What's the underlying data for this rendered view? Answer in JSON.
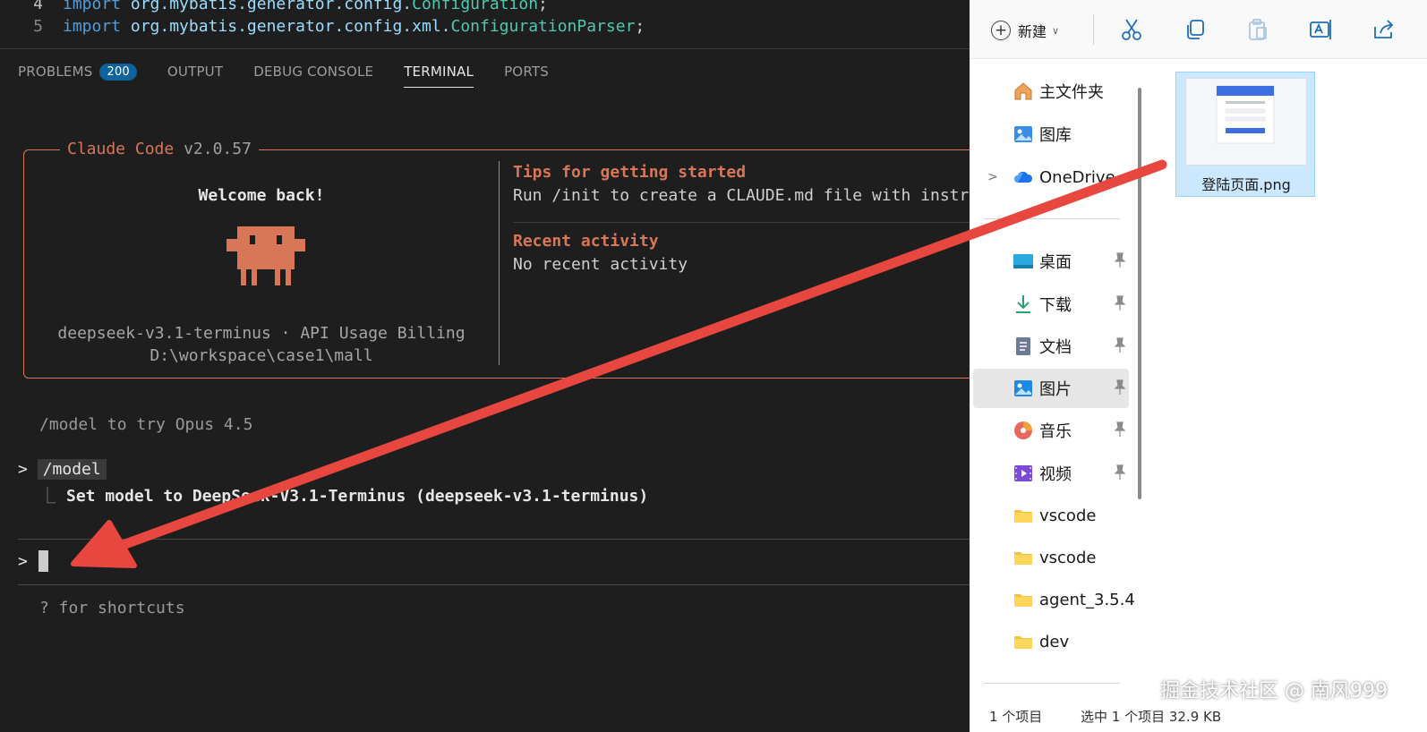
{
  "editor": {
    "lines": [
      {
        "num": "4",
        "kw": "import",
        "pkg": "org.mybatis.generator.config.",
        "cls": "Configuration",
        "end": ";"
      },
      {
        "num": "5",
        "kw": "import",
        "pkg": "org.mybatis.generator.config.xml.",
        "cls": "ConfigurationParser",
        "end": ";"
      }
    ]
  },
  "panel": {
    "tabs": [
      "PROBLEMS",
      "OUTPUT",
      "DEBUG CONSOLE",
      "TERMINAL",
      "PORTS"
    ],
    "problems_badge": "200",
    "active_tab": "TERMINAL"
  },
  "terminal": {
    "app_name": "Claude Code",
    "app_version": "v2.0.57",
    "welcome": "Welcome back!",
    "model_info": "deepseek-v3.1-terminus · API Usage Billing",
    "path": "D:\\workspace\\case1\\mall",
    "tips_heading": "Tips for getting started",
    "tips_text": "Run /init to create a CLAUDE.md file with instructions for Claude",
    "recent_heading": "Recent activity",
    "recent_text": "No recent activity",
    "try_hint": "/model to try Opus 4.5",
    "prompt_symbol": ">",
    "last_command": "/model",
    "result_corner": "⎿",
    "result_text": "Set model to DeepSeek-V3.1-Terminus (deepseek-v3.1-terminus)",
    "shortcuts_hint": "? for shortcuts"
  },
  "explorer": {
    "toolbar": {
      "new_label": "新建",
      "icons": [
        "cut-icon",
        "copy-icon",
        "paste-icon",
        "rename-icon",
        "share-icon"
      ]
    },
    "nav": [
      {
        "label": "主文件夹",
        "icon": "home-icon"
      },
      {
        "label": "图库",
        "icon": "gallery-icon"
      },
      {
        "label": "OneDrive",
        "icon": "onedrive-icon"
      },
      {
        "label": "桌面",
        "icon": "desktop-icon",
        "pinned": true
      },
      {
        "label": "下载",
        "icon": "download-icon",
        "pinned": true
      },
      {
        "label": "文档",
        "icon": "document-icon",
        "pinned": true
      },
      {
        "label": "图片",
        "icon": "pictures-icon",
        "pinned": true
      },
      {
        "label": "音乐",
        "icon": "music-icon",
        "pinned": true
      },
      {
        "label": "视频",
        "icon": "video-icon",
        "pinned": true
      },
      {
        "label": "vscode",
        "icon": "folder-icon"
      },
      {
        "label": "vscode",
        "icon": "folder-icon"
      },
      {
        "label": "agent_3.5.4",
        "icon": "folder-icon"
      },
      {
        "label": "dev",
        "icon": "folder-icon"
      }
    ],
    "selected_nav": "图片",
    "file": {
      "name": "登陆页面.png"
    },
    "status": {
      "count": "1 个项目",
      "selection": "选中 1 个项目  32.9 KB"
    }
  },
  "watermark": "掘金技术社区 @ 南风999",
  "colors": {
    "claude_orange": "#d77757",
    "arrow_red": "#e8473f",
    "selection_blue": "#cce8ff"
  }
}
